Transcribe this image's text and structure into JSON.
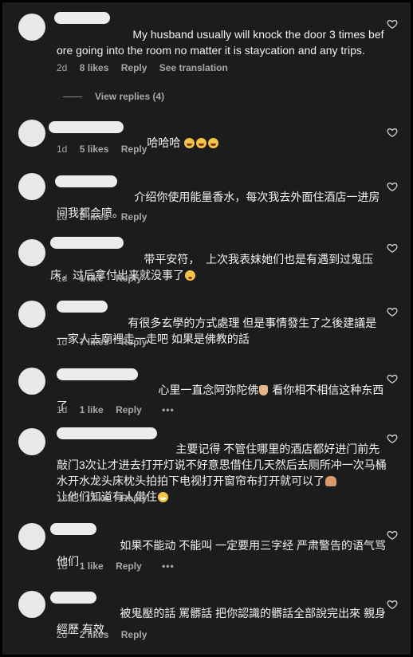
{
  "comments": [
    {
      "text": "My husband usually will knock the door 3 times before going into the room no matter it is staycation and any trips.",
      "time": "2d",
      "likes": "8 likes",
      "reply": "Reply",
      "extra": "See translation",
      "view_replies": "View replies (4)"
    },
    {
      "text": "哈哈哈",
      "time": "1d",
      "likes": "5 likes",
      "reply": "Reply",
      "emoji": [
        "laugh",
        "laugh",
        "laugh"
      ]
    },
    {
      "text": "介绍你使用能量香水，每次我去外面住酒店一进房间我都会喷。",
      "time": "2d",
      "likes": "2 likes",
      "reply": "Reply"
    },
    {
      "text": "带平安符，  上次我表妹她们也是有遇到过鬼压床，过后拿付出来就没事了",
      "time": "1d",
      "likes": "1 like",
      "reply": "Reply",
      "emoji": [
        "dizzy"
      ]
    },
    {
      "text": "有很多玄學的方式處理 但是事情發生了之後建議是一家人去廟裡走一走吧 如果是佛教的話",
      "time": "1d",
      "likes": "7 likes",
      "reply": "Reply"
    },
    {
      "text_before": "心里一直念阿弥陀佛",
      "text_after": "看你相不相信这种东西了",
      "time": "1d",
      "likes": "1 like",
      "reply": "Reply",
      "more": "•••"
    },
    {
      "text": "主要记得 不管住哪里的酒店都好进门前先敲门3次让才进去打开灯说不好意思借住几天然后去厕所冲一次马桶水开水龙头床枕头拍拍下电视打开窗帘布打开就可以了",
      "text_tail": "让他们知道有人借住",
      "time": "13h",
      "likes": "1 like",
      "reply": "Reply"
    },
    {
      "text": "如果不能动 不能叫 一定要用三字经 严肃警告的语气骂他们",
      "time": "1d",
      "likes": "1 like",
      "reply": "Reply",
      "more": "•••"
    },
    {
      "text": "被鬼壓的話 罵髒話 把你認識的髒話全部說完出來 親身經歷 有效",
      "time": "2d",
      "likes": "2 likes",
      "reply": "Reply"
    }
  ],
  "icons": {
    "heart": "heart-outline-icon"
  },
  "colors": {
    "background": "#1c1c1c",
    "text": "#f2f2f2",
    "meta": "#a8a8a8"
  }
}
